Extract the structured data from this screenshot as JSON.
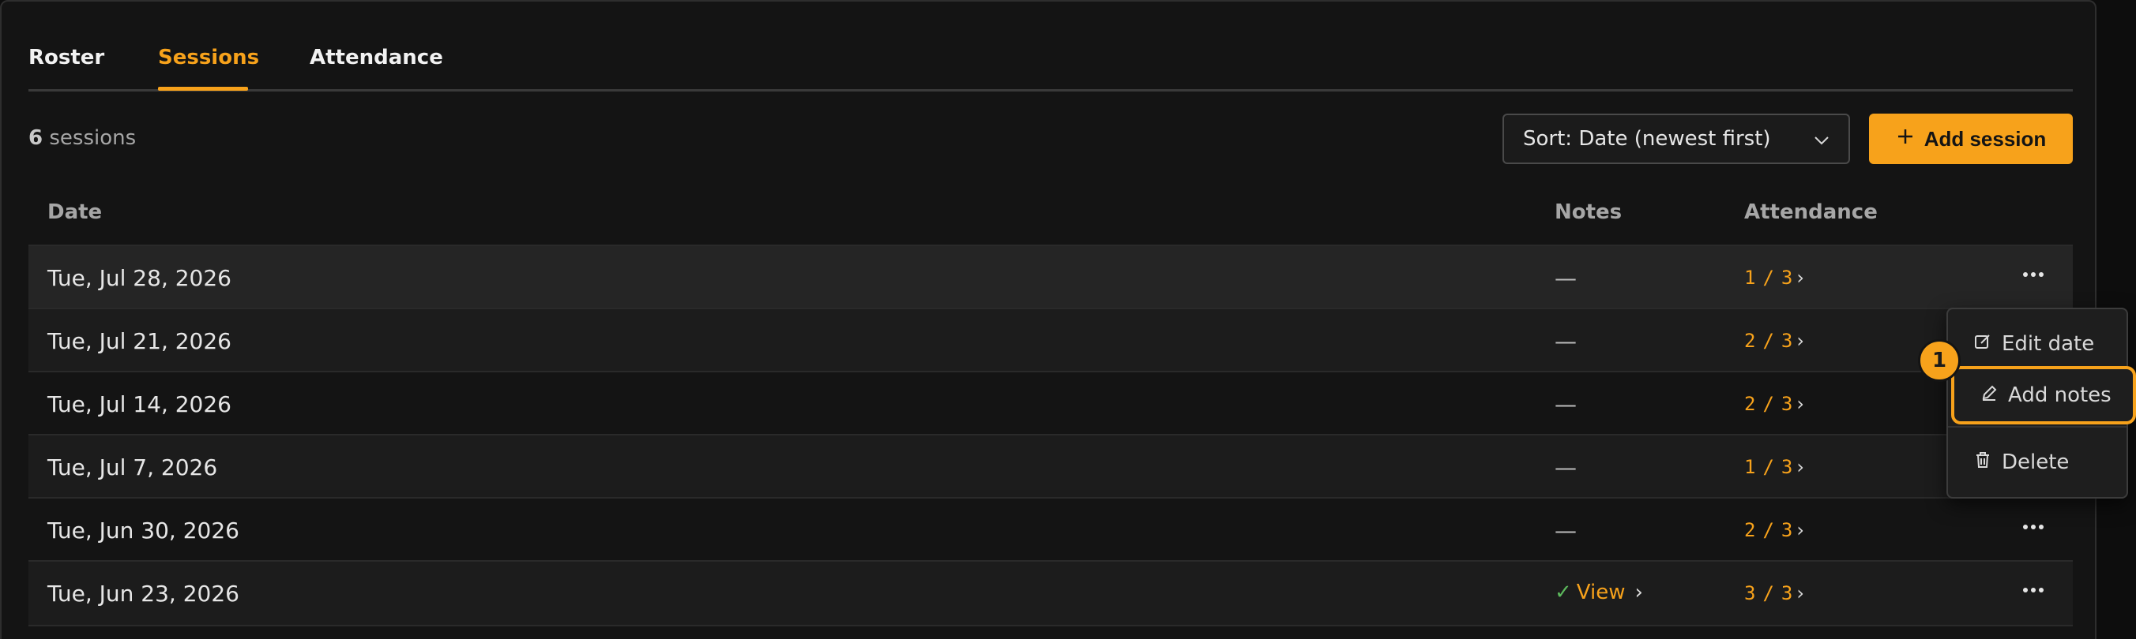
{
  "tabs": [
    {
      "label": "Roster",
      "active": false
    },
    {
      "label": "Sessions",
      "active": true
    },
    {
      "label": "Attendance",
      "active": false
    }
  ],
  "toolbar": {
    "count": "6",
    "count_suffix": " sessions",
    "sort_label": "Sort: Date (newest first)",
    "add_label": "Add session"
  },
  "table": {
    "headers": {
      "date": "Date",
      "notes": "Notes",
      "attendance": "Attendance"
    },
    "rows": [
      {
        "date": "Tue, Jul 28, 2026",
        "notes": "—",
        "present": "1",
        "total": "3"
      },
      {
        "date": "Tue, Jul 21, 2026",
        "notes": "—",
        "present": "2",
        "total": "3"
      },
      {
        "date": "Tue, Jul 14, 2026",
        "notes": "—",
        "present": "2",
        "total": "3"
      },
      {
        "date": "Tue, Jul 7, 2026",
        "notes": "—",
        "present": "1",
        "total": "3"
      },
      {
        "date": "Tue, Jun 30, 2026",
        "notes": "—",
        "present": "2",
        "total": "3"
      },
      {
        "date": "Tue, Jun 23, 2026",
        "notes": "View",
        "present": "3",
        "total": "3"
      }
    ],
    "slash": "/"
  },
  "menu": {
    "edit_date": "Edit date",
    "add_notes": "Add notes",
    "delete": "Delete"
  },
  "badge": "1",
  "colors": {
    "accent": "#f7a21b",
    "check": "#5cb85c",
    "background": "#141414"
  }
}
